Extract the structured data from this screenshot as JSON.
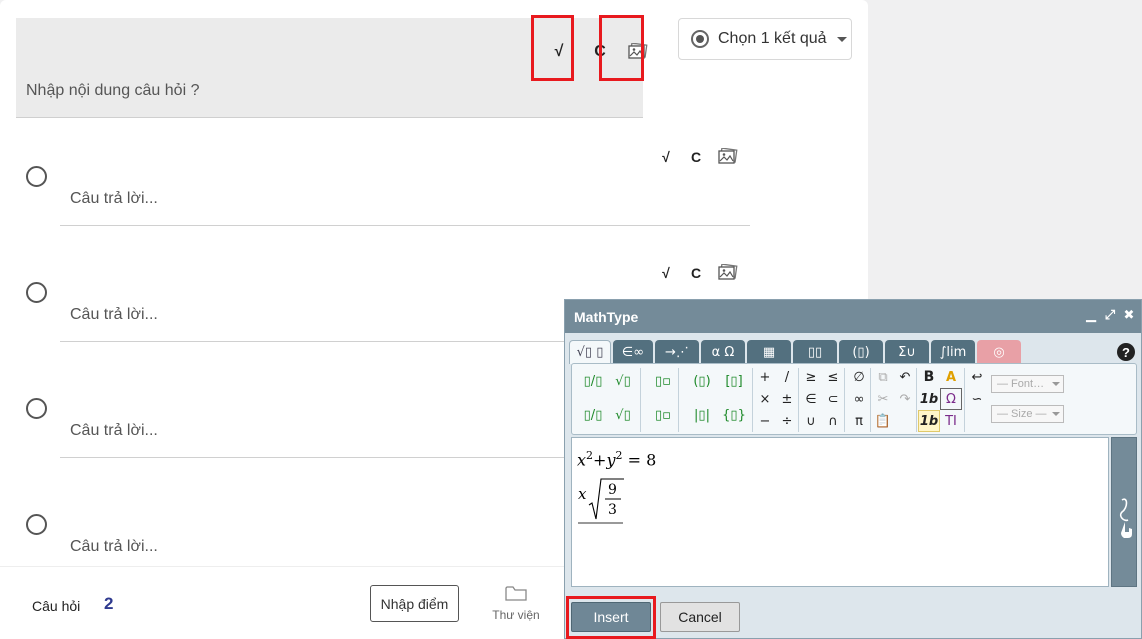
{
  "question": {
    "placeholder": "Nhập nội dung câu hỏi ?",
    "tool_labels": {
      "sqrt": "√",
      "c": "C"
    },
    "type_select": {
      "value": "Chọn 1 kết quả"
    }
  },
  "answers": [
    {
      "placeholder": "Câu trả lời..."
    },
    {
      "placeholder": "Câu trả lời..."
    },
    {
      "placeholder": "Câu trả lời..."
    },
    {
      "placeholder": "Câu trả lời..."
    }
  ],
  "footer": {
    "label": "Câu hỏi",
    "count": "2",
    "score_button": "Nhập điểm",
    "library": "Thư viện"
  },
  "mathtype": {
    "title": "MathType",
    "help": "?",
    "tabs": [
      "√▯ ▯",
      "∈∞",
      "→⋰",
      "α Ω",
      "▦",
      "▯▯",
      "(▯)",
      "Σ∪",
      "∫lim",
      "◎"
    ],
    "toolbar": {
      "frac": "▯/▯",
      "sqrt": "√▯",
      "sup": "▯▫",
      "paren": "(▯)",
      "bracket": "[▯]",
      "plus": "+",
      "slash": "/",
      "geq": "≥",
      "leq": "≤",
      "empty": "∅",
      "times": "×",
      "pm": "±",
      "in": "∈",
      "subset": "⊂",
      "infty": "∞",
      "minus": "−",
      "div": "÷",
      "cup": "∪",
      "cap": "∩",
      "pi": "π",
      "abs": "|▯|",
      "brace": "{▯}",
      "bold": "B",
      "italic": "1b",
      "italic_sel": "1b",
      "omega": "Ω",
      "text": "TI"
    },
    "font_select": "— Font…",
    "size_select": "— Size —",
    "equation": {
      "line1": {
        "x": "x",
        "y": "y",
        "exp": "2",
        "plus": "+",
        "eq": "=",
        "rhs": "8"
      },
      "line2": {
        "x": "x",
        "num": "9",
        "den": "3"
      }
    },
    "insert": "Insert",
    "cancel": "Cancel"
  },
  "colors": {
    "highlight": "#e8191e",
    "dialog_header": "#748b99",
    "count": "#2f3a8f"
  }
}
